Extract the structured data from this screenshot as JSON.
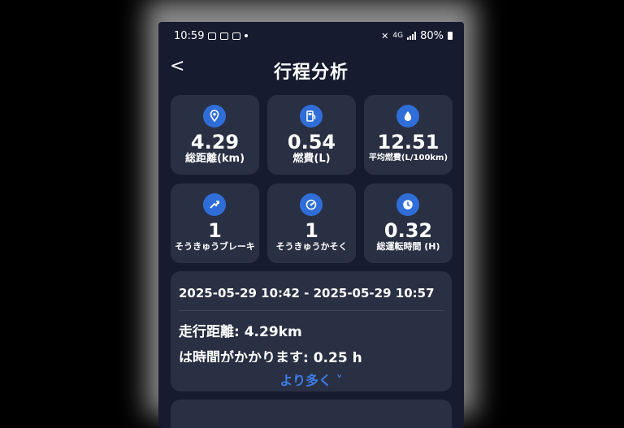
{
  "status": {
    "time": "10:59",
    "network": "4G",
    "battery": "80%"
  },
  "header": {
    "back_glyph": "<",
    "title": "行程分析"
  },
  "stats": [
    {
      "icon": "location-pin-icon",
      "value": "4.29",
      "label": "総距離(km)"
    },
    {
      "icon": "fuel-pump-icon",
      "value": "0.54",
      "label": "燃費(L)"
    },
    {
      "icon": "droplet-icon",
      "value": "12.51",
      "label": "平均燃費(L/100km)"
    },
    {
      "icon": "sudden-brake-icon",
      "value": "1",
      "label": "そうきゅうブレーキ"
    },
    {
      "icon": "sudden-accel-icon",
      "value": "1",
      "label": "そうきゅうかそく"
    },
    {
      "icon": "clock-icon",
      "value": "0.32",
      "label": "総運転時間 (H)"
    }
  ],
  "trip": {
    "range": "2025-05-29 10:42 - 2025-05-29 10:57",
    "distance": "走行距離: 4.29km",
    "duration": "は時間がかかります: 0.25 h",
    "more_label": "より多く ˅"
  },
  "colors": {
    "background": "#161b2f",
    "card": "#2a3043",
    "accent": "#2f6ed9",
    "link": "#3d7de8"
  }
}
